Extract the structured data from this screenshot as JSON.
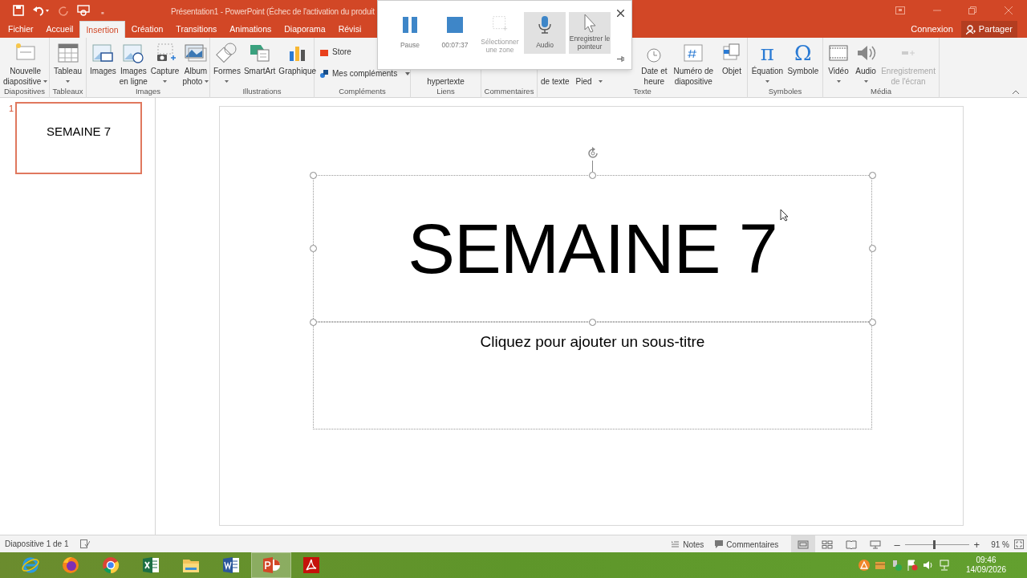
{
  "title_bar": {
    "title": "Présentation1 - PowerPoint (Échec de l'activation du produit",
    "qat_more": "₌"
  },
  "tabs": [
    {
      "label": "Fichier",
      "selected": false
    },
    {
      "label": "Accueil",
      "selected": false
    },
    {
      "label": "Insertion",
      "selected": true
    },
    {
      "label": "Création",
      "selected": false
    },
    {
      "label": "Transitions",
      "selected": false
    },
    {
      "label": "Animations",
      "selected": false
    },
    {
      "label": "Diaporama",
      "selected": false
    },
    {
      "label": "Révisi",
      "selected": false
    }
  ],
  "account": {
    "sign_in": "Connexion",
    "share": "Partager"
  },
  "ribbon": [
    {
      "label": "Diapositives",
      "items": [
        {
          "lines": [
            "Nouvelle",
            "diapositive"
          ],
          "dropdown": true
        }
      ]
    },
    {
      "label": "Tableaux",
      "items": [
        {
          "lines": [
            "Tableau"
          ],
          "dropdown": true
        }
      ]
    },
    {
      "label": "Images",
      "items": [
        {
          "lines": [
            "Images"
          ]
        },
        {
          "lines": [
            "Images",
            "en ligne"
          ]
        },
        {
          "lines": [
            "Capture"
          ],
          "dropdown": true
        },
        {
          "lines": [
            "Album",
            "photo"
          ],
          "dropdown": true
        }
      ]
    },
    {
      "label": "Illustrations",
      "items": [
        {
          "lines": [
            "Formes"
          ],
          "dropdown": true
        },
        {
          "lines": [
            "SmartArt"
          ]
        },
        {
          "lines": [
            "Graphique"
          ]
        }
      ]
    },
    {
      "label": "Compléments",
      "items": [
        {
          "lines": [
            "Store"
          ],
          "kind": "small"
        },
        {
          "lines": [
            "Mes compléments"
          ],
          "kind": "small",
          "dropdown": true
        }
      ]
    },
    {
      "label": "Liens",
      "items": [
        {
          "lines": [
            "hypertexte"
          ],
          "covered": true
        }
      ]
    },
    {
      "label": "Commentaires"
    },
    {
      "label": "Texte",
      "items": [
        {
          "lines": [
            "de texte"
          ],
          "covered": true
        },
        {
          "lines": [
            "Pied"
          ],
          "covered": true
        },
        {
          "covered": true,
          "dropdown": true
        },
        {
          "lines": [
            "Date et",
            "heure"
          ]
        },
        {
          "lines": [
            "Numéro de",
            "diapositive"
          ]
        },
        {
          "lines": [
            "Objet"
          ]
        }
      ]
    },
    {
      "label": "Symboles",
      "items": [
        {
          "symbol": "π",
          "lines": [
            "Équation"
          ],
          "dropdown": true
        },
        {
          "symbol": "Ω",
          "lines": [
            "Symbole"
          ]
        }
      ]
    },
    {
      "label": "Média",
      "items": [
        {
          "lines": [
            "Vidéo"
          ],
          "dropdown": true
        },
        {
          "lines": [
            "Audio"
          ],
          "dropdown": true
        },
        {
          "lines": [
            "Enregistrement",
            "de l'écran"
          ],
          "disabled": true
        }
      ]
    }
  ],
  "recorder": {
    "buttons": [
      {
        "label": "Pause",
        "kind": "pause"
      },
      {
        "label": "00:07:37",
        "kind": "stop"
      },
      {
        "label": "Sélectionner une zone",
        "kind": "area",
        "disabled": true
      },
      {
        "label": "Audio",
        "kind": "mic",
        "on": true
      },
      {
        "label": "Enregistrer le pointeur",
        "kind": "pointer",
        "on": true
      }
    ]
  },
  "slides_panel": [
    {
      "number": "1",
      "title": "SEMAINE 7",
      "selected": true
    }
  ],
  "slide": {
    "title": "SEMAINE 7",
    "subtitle_placeholder": "Cliquez pour ajouter un sous-titre"
  },
  "status_bar": {
    "slide_info": "Diapositive 1 de 1",
    "notes": "Notes",
    "comments": "Commentaires",
    "views": [
      {
        "selected": true
      },
      {
        "selected": false
      },
      {
        "selected": false
      },
      {
        "selected": false
      }
    ],
    "zoom_out": "–",
    "zoom_in": "+",
    "zoom": {
      "level": 0.45
    },
    "zoom_reading": "91 %"
  },
  "taskbar": {
    "apps": [
      {
        "kind": "ie",
        "selected": false
      },
      {
        "kind": "firefox",
        "selected": false
      },
      {
        "kind": "chrome",
        "selected": false
      },
      {
        "kind": "excel",
        "selected": false
      },
      {
        "kind": "folder",
        "selected": false
      },
      {
        "kind": "word",
        "selected": false
      },
      {
        "kind": "powerpoint",
        "selected": true
      },
      {
        "kind": "pdf",
        "selected": false
      }
    ],
    "time": "09:46",
    "date": "14/09/2026"
  }
}
